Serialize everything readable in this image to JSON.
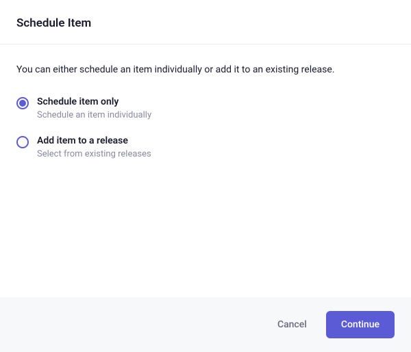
{
  "header": {
    "title": "Schedule Item"
  },
  "content": {
    "description": "You can either schedule an item individually or add it to an existing release."
  },
  "options": [
    {
      "title": "Schedule item only",
      "subtitle": "Schedule an item individually",
      "selected": true
    },
    {
      "title": "Add item to a release",
      "subtitle": "Select from existing releases",
      "selected": false
    }
  ],
  "footer": {
    "cancel_label": "Cancel",
    "continue_label": "Continue"
  }
}
